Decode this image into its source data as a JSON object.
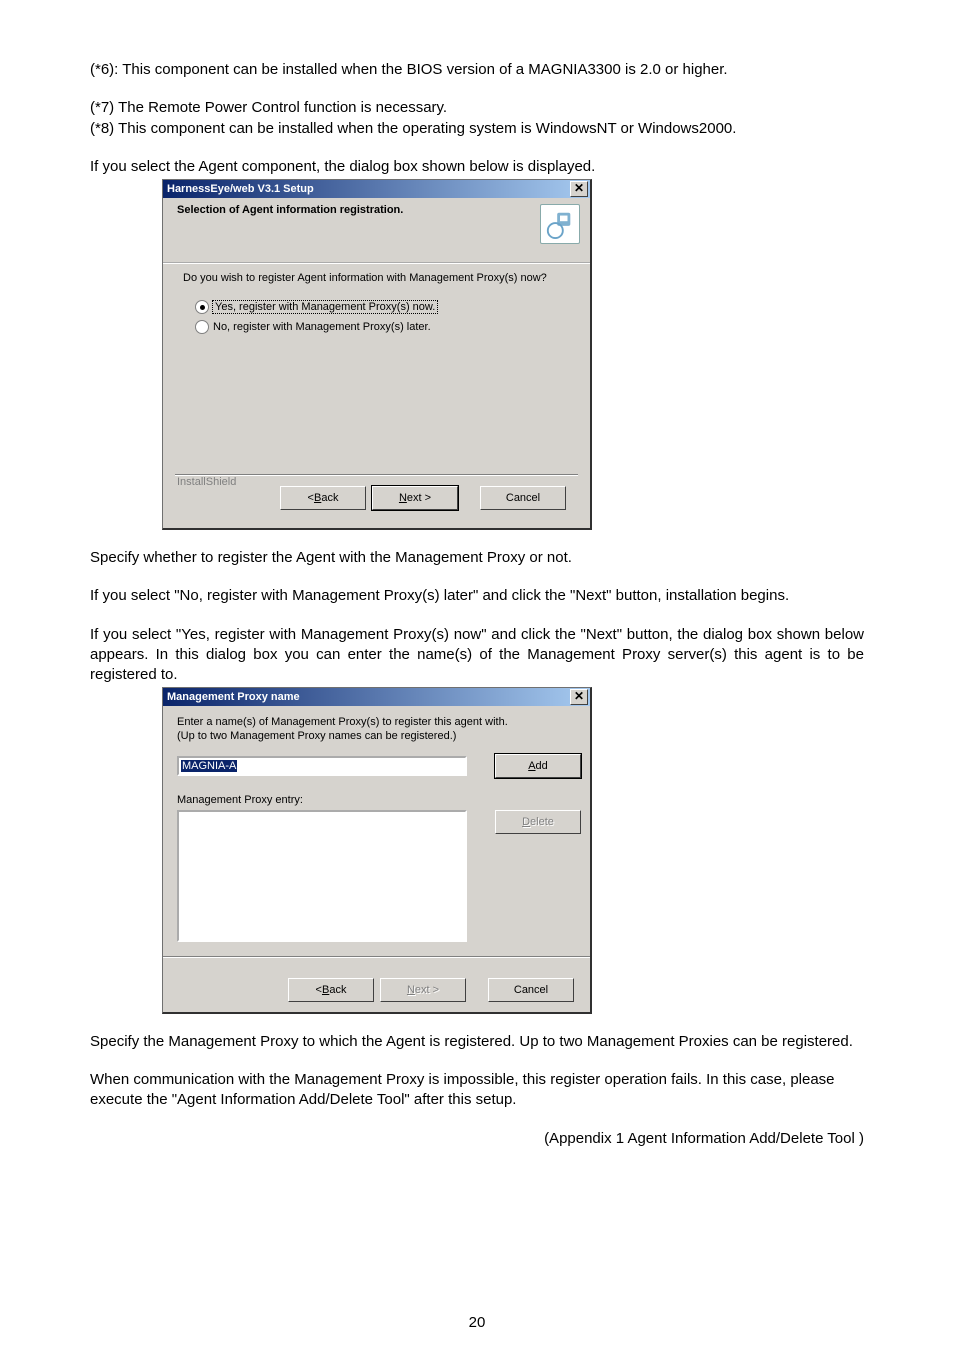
{
  "paras": {
    "p1": "(*6): This component can be installed when the BIOS version of a MAGNIA3300 is 2.0 or higher.",
    "p2": "(*7) The Remote Power Control function is necessary.",
    "p3": "(*8) This component can be installed when the operating system is WindowsNT or Windows2000.",
    "p4": "If you select the Agent component, the dialog box shown below is displayed.",
    "p5": "Specify whether to register the Agent with the Management Proxy or not.",
    "p6": "If you select \"No, register with Management Proxy(s) later\" and click the \"Next\" button, installation begins.",
    "p7": "If you select \"Yes, register with Management Proxy(s) now\" and click the \"Next\" button, the dialog box shown below appears. In this dialog box you can enter the name(s) of the Management Proxy server(s) this agent is to be registered to.",
    "p8": "Specify the Management Proxy to which the Agent is registered. Up to two Management Proxies can be registered.",
    "p9": "When communication with the Management Proxy is impossible, this register operation fails. In this case, please execute the \"Agent Information Add/Delete Tool\" after this setup.",
    "p10": "(Appendix 1 Agent Information Add/Delete Tool )"
  },
  "dialog1": {
    "title": "HarnessEye/web V3.1 Setup",
    "subtitle": "Selection of Agent information registration.",
    "prompt": "Do you wish to register Agent information with Management Proxy(s) now?",
    "opt_yes": "Yes, register with Management Proxy(s) now.",
    "opt_no": "No, register with Management Proxy(s) later.",
    "legend": "InstallShield",
    "back_pre": "< ",
    "back_u": "B",
    "back_post": "ack",
    "next_u": "N",
    "next_post": "ext >",
    "cancel": "Cancel"
  },
  "dialog2": {
    "title": "Management Proxy name",
    "instr1": "Enter a name(s) of Management Proxy(s) to register this agent with.",
    "instr2": "(Up to two Management Proxy names can be registered.)",
    "input_value": "MAGNIA-A",
    "add_u": "A",
    "add_post": "dd",
    "list_label": "Management Proxy entry:",
    "delete_u": "D",
    "delete_post": "elete",
    "back_pre": "< ",
    "back_u": "B",
    "back_post": "ack",
    "next_u": "N",
    "next_post": "ext >",
    "cancel": "Cancel"
  },
  "page_number": "20"
}
